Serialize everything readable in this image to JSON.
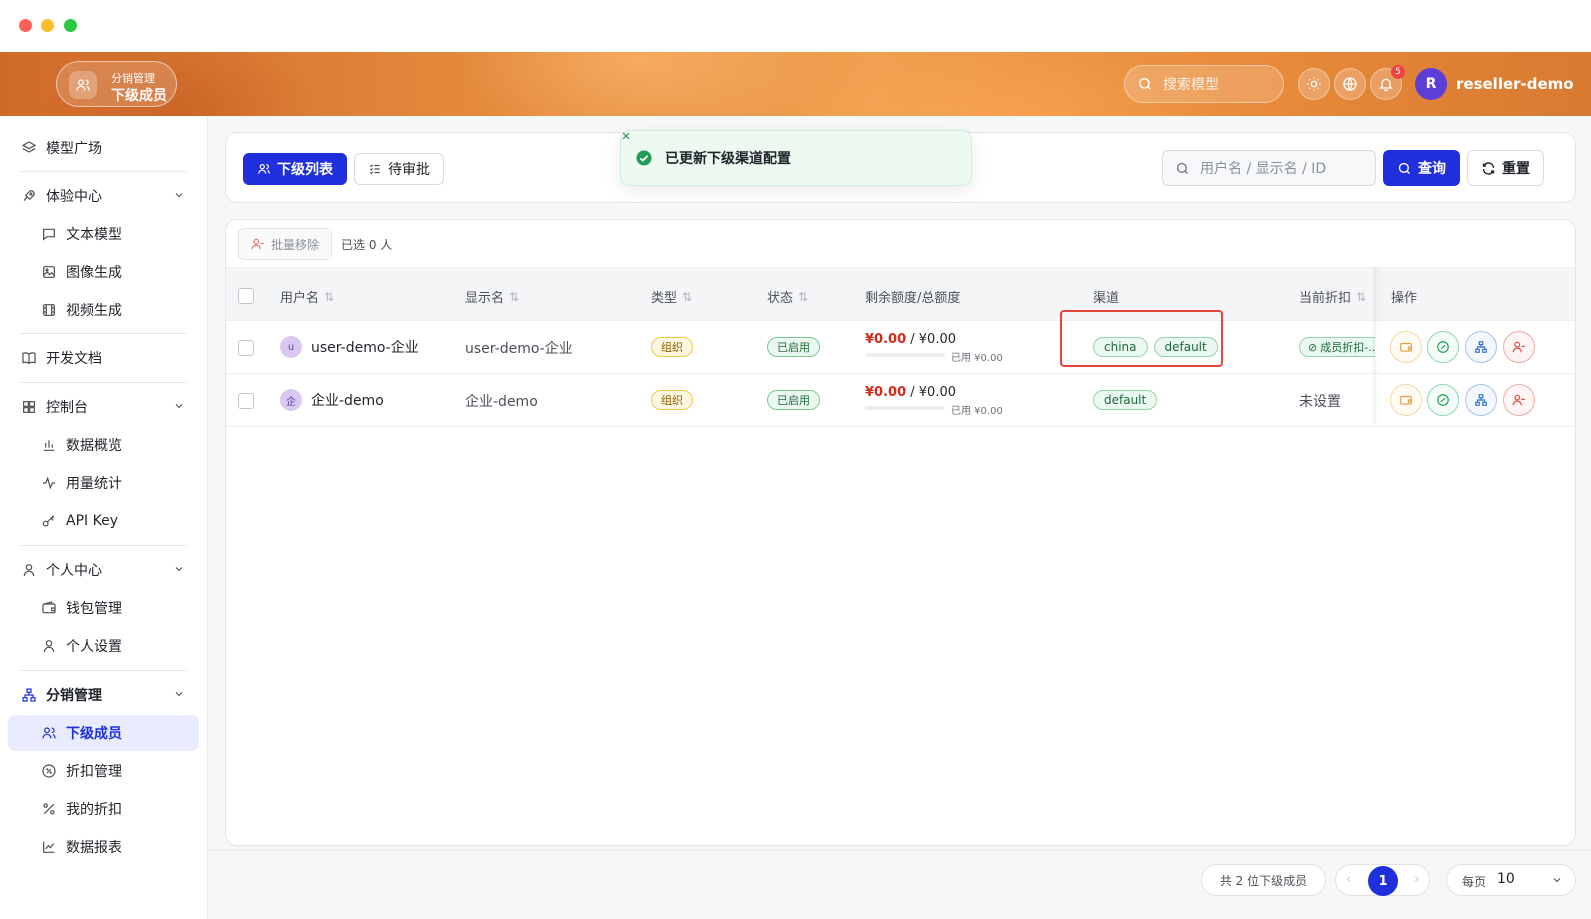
{
  "header": {
    "brand_sub": "分销管理",
    "brand_main": "下级成员",
    "search_placeholder": "搜索模型",
    "notification_count": "5",
    "avatar_letter": "R",
    "username": "reseller-demo"
  },
  "sidebar": {
    "items": [
      {
        "label": "模型广场",
        "icon": "layers-icon"
      },
      {
        "label": "体验中心",
        "icon": "rocket-icon"
      },
      {
        "label": "文本模型",
        "icon": "chat-icon"
      },
      {
        "label": "图像生成",
        "icon": "image-icon"
      },
      {
        "label": "视频生成",
        "icon": "film-icon"
      },
      {
        "label": "开发文档",
        "icon": "book-icon"
      },
      {
        "label": "控制台",
        "icon": "grid-icon"
      },
      {
        "label": "数据概览",
        "icon": "bar-chart-icon"
      },
      {
        "label": "用量统计",
        "icon": "activity-icon"
      },
      {
        "label": "API Key",
        "icon": "key-icon"
      },
      {
        "label": "个人中心",
        "icon": "user-icon"
      },
      {
        "label": "钱包管理",
        "icon": "wallet-icon"
      },
      {
        "label": "个人设置",
        "icon": "user-icon"
      },
      {
        "label": "分销管理",
        "icon": "network-icon"
      },
      {
        "label": "下级成员",
        "icon": "users-icon"
      },
      {
        "label": "折扣管理",
        "icon": "badge-percent-icon"
      },
      {
        "label": "我的折扣",
        "icon": "percent-icon"
      },
      {
        "label": "数据报表",
        "icon": "line-chart-icon"
      }
    ]
  },
  "toolbar": {
    "tab_list": "下级列表",
    "tab_pending": "待审批",
    "search_placeholder": "用户名 / 显示名 / ID",
    "query_label": "查询",
    "reset_label": "重置"
  },
  "toast": {
    "message": "已更新下级渠道配置"
  },
  "table": {
    "batch_remove": "批量移除",
    "selected_count": "已选 0 人",
    "columns": [
      "用户名",
      "显示名",
      "类型",
      "状态",
      "剩余额度/总额度",
      "渠道",
      "当前折扣",
      "操作"
    ],
    "rows": [
      {
        "avatar": "u",
        "username": "user-demo-企业",
        "display_name": "user-demo-企业",
        "type": "组织",
        "status": "已启用",
        "remaining": "¥0.00",
        "total": "/ ¥0.00",
        "used": "已用 ¥0.00",
        "channels": [
          "china",
          "default"
        ],
        "discount": "成员折扣-..."
      },
      {
        "avatar": "企",
        "username": "企业-demo",
        "display_name": "企业-demo",
        "type": "组织",
        "status": "已启用",
        "remaining": "¥0.00",
        "total": "/ ¥0.00",
        "used": "已用 ¥0.00",
        "channels": [
          "default"
        ],
        "discount": "未设置"
      }
    ]
  },
  "footer": {
    "total": "共 2 位下级成员",
    "current_page": "1",
    "per_page_label": "每页",
    "per_page_value": "10"
  },
  "colors": {
    "accent": "#1f2fdb",
    "header_orange": "#e48a3c",
    "money_red": "#d42a1a",
    "highlight_red": "#e5453a"
  }
}
